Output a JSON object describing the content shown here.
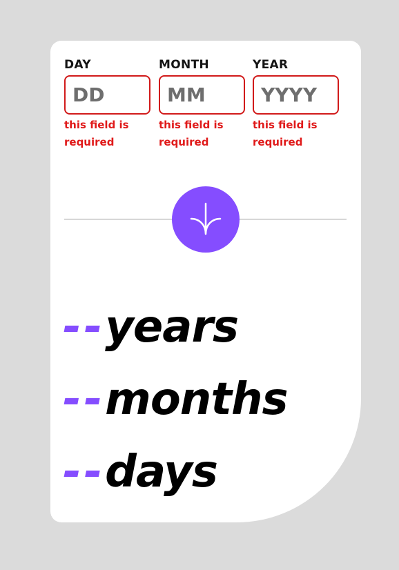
{
  "form": {
    "fields": [
      {
        "label": "DAY",
        "placeholder": "DD",
        "value": "",
        "error": "this field is required"
      },
      {
        "label": "MONTH",
        "placeholder": "MM",
        "value": "",
        "error": "this field is required"
      },
      {
        "label": "YEAR",
        "placeholder": "YYYY",
        "value": "",
        "error": "this field is required"
      }
    ],
    "submit_icon": "arrow-down-icon"
  },
  "results": [
    {
      "value": "--",
      "unit": "years"
    },
    {
      "value": "--",
      "unit": "months"
    },
    {
      "value": "--",
      "unit": "days"
    }
  ],
  "colors": {
    "background": "#dbdbdb",
    "card": "#ffffff",
    "accent": "#854dff",
    "error": "#e01a1a",
    "text": "#151515",
    "divider": "#9d9d9d"
  }
}
